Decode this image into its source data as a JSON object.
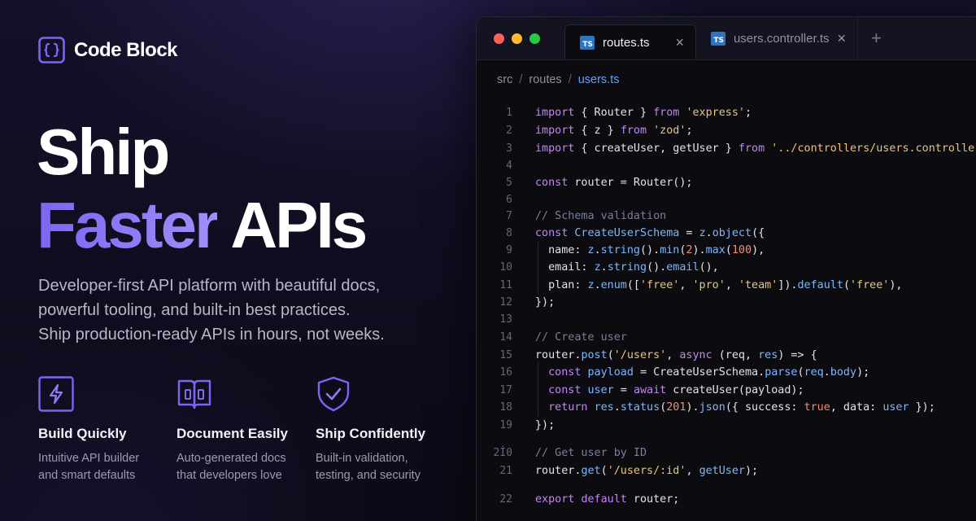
{
  "brand": {
    "name": "Code Block",
    "icon": "curly-braces-icon"
  },
  "hero": {
    "line1": "Ship",
    "line2_accent": "Faster",
    "line2_rest": " APIs",
    "subcopy": [
      "Developer-first API platform with beautiful docs,",
      "powerful tooling, and built-in best practices.",
      "Ship production-ready APIs in hours, not weeks."
    ]
  },
  "features": [
    {
      "icon": "lightning-bolt-icon",
      "title": "Build Quickly",
      "desc": [
        "Intuitive API builder",
        "and smart defaults"
      ]
    },
    {
      "icon": "open-book-icon",
      "title": "Document Easily",
      "desc": [
        "Auto-generated docs",
        "that developers love"
      ]
    },
    {
      "icon": "shield-check-icon",
      "title": "Ship Confidently",
      "desc": [
        "Built-in validation,",
        "testing, and security"
      ]
    }
  ],
  "colors": {
    "accent": "#7a66f2",
    "background": "#0d0c18",
    "link": "#5aa5ff"
  },
  "editor": {
    "tabs": [
      {
        "badge": "TS",
        "label": "routes.ts",
        "active": true
      },
      {
        "badge": "TS",
        "label": "users.controller.ts",
        "active": false
      }
    ],
    "breadcrumb": [
      "src",
      "routes",
      "users.ts"
    ],
    "line_numbers": [
      "1",
      "2",
      "3",
      "4",
      "5",
      "6",
      "7",
      "8",
      "9",
      "10",
      "11",
      "12",
      "13",
      "14",
      "15",
      "16",
      "17",
      "18",
      "19",
      "2İ0",
      "21",
      "22"
    ],
    "code_lines": [
      [
        [
          "kw",
          "import"
        ],
        [
          "pl",
          " { Router } "
        ],
        [
          "kw",
          "from"
        ],
        [
          "pl",
          " "
        ],
        [
          "str",
          "'express'"
        ],
        [
          "pl",
          ";"
        ]
      ],
      [
        [
          "kw",
          "import"
        ],
        [
          "pl",
          " { z } "
        ],
        [
          "kw",
          "from"
        ],
        [
          "pl",
          " "
        ],
        [
          "str",
          "'zod'"
        ],
        [
          "pl",
          ";"
        ]
      ],
      [
        [
          "kw",
          "import"
        ],
        [
          "pl",
          " { createUser, getUser } "
        ],
        [
          "kw",
          "from"
        ],
        [
          "pl",
          " "
        ],
        [
          "str",
          "'../controllers/users.controller'"
        ],
        [
          "pl",
          ";"
        ]
      ],
      [],
      [
        [
          "kw",
          "const"
        ],
        [
          "pl",
          " router = Router();"
        ]
      ],
      [],
      [
        [
          "cm",
          "// Schema validation"
        ]
      ],
      [
        [
          "kw",
          "const"
        ],
        [
          "pl",
          " "
        ],
        [
          "fn",
          "CreateUserSchema"
        ],
        [
          "pl",
          " = "
        ],
        [
          "fn",
          "z"
        ],
        [
          "pl",
          "."
        ],
        [
          "fn",
          "object"
        ],
        [
          "pl",
          "({"
        ]
      ],
      [
        [
          "pl",
          "  name: "
        ],
        [
          "fn",
          "z"
        ],
        [
          "pl",
          "."
        ],
        [
          "fn",
          "string"
        ],
        [
          "pl",
          "()."
        ],
        [
          "fn",
          "min"
        ],
        [
          "pl",
          "("
        ],
        [
          "num",
          "2"
        ],
        [
          "pl",
          ")."
        ],
        [
          "fn",
          "max"
        ],
        [
          "pl",
          "("
        ],
        [
          "num",
          "100"
        ],
        [
          "pl",
          "),"
        ]
      ],
      [
        [
          "pl",
          "  email: "
        ],
        [
          "fn",
          "z"
        ],
        [
          "pl",
          "."
        ],
        [
          "fn",
          "string"
        ],
        [
          "pl",
          "()."
        ],
        [
          "fn",
          "email"
        ],
        [
          "pl",
          "(),"
        ]
      ],
      [
        [
          "pl",
          "  plan: "
        ],
        [
          "fn",
          "z"
        ],
        [
          "pl",
          "."
        ],
        [
          "fn",
          "enum"
        ],
        [
          "pl",
          "(["
        ],
        [
          "str",
          "'free'"
        ],
        [
          "pl",
          ", "
        ],
        [
          "str",
          "'pro'"
        ],
        [
          "pl",
          ", "
        ],
        [
          "str",
          "'team'"
        ],
        [
          "pl",
          "])."
        ],
        [
          "fn",
          "default"
        ],
        [
          "pl",
          "("
        ],
        [
          "str",
          "'free'"
        ],
        [
          "pl",
          "),"
        ]
      ],
      [
        [
          "pl",
          "});"
        ]
      ],
      [],
      [
        [
          "cm",
          "// Create user"
        ]
      ],
      [
        [
          "pl",
          "router."
        ],
        [
          "fn",
          "post"
        ],
        [
          "pl",
          "("
        ],
        [
          "str",
          "'/users'"
        ],
        [
          "pl",
          ", "
        ],
        [
          "kw",
          "async"
        ],
        [
          "pl",
          " (req, "
        ],
        [
          "fn",
          "res"
        ],
        [
          "pl",
          ") => {"
        ]
      ],
      [
        [
          "pl",
          "  "
        ],
        [
          "kw",
          "const"
        ],
        [
          "pl",
          " "
        ],
        [
          "fn",
          "payload"
        ],
        [
          "pl",
          " = CreateUserSchema."
        ],
        [
          "fn",
          "parse"
        ],
        [
          "pl",
          "("
        ],
        [
          "fn",
          "req"
        ],
        [
          "pl",
          "."
        ],
        [
          "fn",
          "body"
        ],
        [
          "pl",
          ");"
        ]
      ],
      [
        [
          "pl",
          "  "
        ],
        [
          "kw",
          "const"
        ],
        [
          "pl",
          " "
        ],
        [
          "fn",
          "user"
        ],
        [
          "pl",
          " = "
        ],
        [
          "kw",
          "await"
        ],
        [
          "pl",
          " createUser(payload);"
        ]
      ],
      [
        [
          "pl",
          "  "
        ],
        [
          "kw",
          "return"
        ],
        [
          "pl",
          " "
        ],
        [
          "fn",
          "res"
        ],
        [
          "pl",
          "."
        ],
        [
          "fn",
          "status"
        ],
        [
          "pl",
          "("
        ],
        [
          "num",
          "201"
        ],
        [
          "pl",
          ")."
        ],
        [
          "fn",
          "json"
        ],
        [
          "pl",
          "({ success: "
        ],
        [
          "bool",
          "true"
        ],
        [
          "pl",
          ", data: "
        ],
        [
          "fn",
          "user"
        ],
        [
          "pl",
          " });"
        ]
      ],
      [
        [
          "pl",
          "});"
        ]
      ],
      [
        [
          "cm",
          "// Get user by ID"
        ]
      ],
      [
        [
          "pl",
          "router."
        ],
        [
          "fn",
          "get"
        ],
        [
          "pl",
          "("
        ],
        [
          "str",
          "'/users/:id'"
        ],
        [
          "pl",
          ", "
        ],
        [
          "fn",
          "getUser"
        ],
        [
          "pl",
          ");"
        ]
      ],
      [
        [
          "kw",
          "export"
        ],
        [
          "pl",
          " "
        ],
        [
          "kw",
          "default"
        ],
        [
          "pl",
          " router;"
        ]
      ]
    ]
  }
}
